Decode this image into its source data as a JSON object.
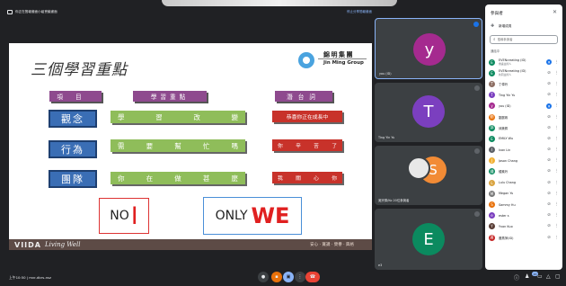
{
  "presentation": {
    "title": "你正在簡報畫面小組會議畫面",
    "right_text": "停止分享簡報畫面"
  },
  "slide": {
    "title": "三個學習重點",
    "logo": {
      "cn": "錦明集團",
      "en": "Jin Ming Group"
    },
    "headers": [
      "項目",
      "學習重點",
      "潛台詞"
    ],
    "rows": [
      {
        "category": "觀念",
        "points": [
          "學",
          "習",
          "改",
          "變"
        ],
        "encouragement": "恭喜你正在成長中"
      },
      {
        "category": "行為",
        "points": [
          "需",
          "要",
          "幫",
          "忙",
          "嗎"
        ],
        "encouragement": [
          "你",
          "辛",
          "苦",
          "了"
        ]
      },
      {
        "category": "團隊",
        "points": [
          "你",
          "在",
          "做",
          "甚",
          "麼"
        ],
        "encouragement": [
          "我",
          "關",
          "心",
          "你"
        ]
      }
    ],
    "no_box": {
      "small": "NO",
      "big": "I"
    },
    "only_box": {
      "small": "ONLY",
      "big": "WE"
    },
    "footer": {
      "brand": "VIIDA",
      "tagline": "Living Well",
      "right": "安心 · 賞識 · 榮譽 · 興格"
    }
  },
  "tiles": [
    {
      "initial": "y",
      "color": "#a52a8f",
      "name": "you (ID)"
    },
    {
      "initial": "T",
      "color": "#7b3fbf",
      "name": "Ting Yin Yu"
    },
    {
      "initial": "S",
      "color": "#f28b35",
      "name": "吳宗偉/Ko 20位參與者"
    },
    {
      "initial": "E",
      "color": "#0b8a5f",
      "name": "e3"
    }
  ],
  "panel": {
    "title": "參與者",
    "add_label": "新增成員",
    "search_placeholder": "搜尋參與者",
    "in_call_label": "通話中",
    "participants": [
      {
        "initial": "E",
        "color": "#0b8a5f",
        "name": "EVENcreating (ID)",
        "sub": "會議主持人",
        "mic": "blue"
      },
      {
        "initial": "E",
        "color": "#0b8a5f",
        "name": "EVENcreating (ID)",
        "sub": "共同主持人",
        "mic": "muted"
      },
      {
        "initial": "丁",
        "color": "#8d6e63",
        "name": "丁偉玲",
        "sub": "",
        "mic": "muted"
      },
      {
        "initial": "T",
        "color": "#7b3fbf",
        "name": "Ting Yin Yu",
        "sub": "",
        "mic": "muted"
      },
      {
        "initial": "y",
        "color": "#a52a8f",
        "name": "you (ID)",
        "sub": "",
        "mic": "blue"
      },
      {
        "initial": "劉",
        "color": "#e8710a",
        "name": "劉麗珠",
        "sub": "",
        "mic": "muted"
      },
      {
        "initial": "邱",
        "color": "#0b8a5f",
        "name": "邱美佩",
        "sub": "",
        "mic": "muted"
      },
      {
        "initial": "E",
        "color": "#0b8a5f",
        "name": "EMILY Wu",
        "sub": "",
        "mic": "muted"
      },
      {
        "initial": "I",
        "color": "#5f6368",
        "name": "Ivan Lin",
        "sub": "",
        "mic": "muted"
      },
      {
        "initial": "J",
        "color": "#f2b134",
        "name": "Jason Chang",
        "sub": "",
        "mic": "muted"
      },
      {
        "initial": "鍾",
        "color": "#0b8a5f",
        "name": "鍾素玲",
        "sub": "",
        "mic": "muted"
      },
      {
        "initial": "L",
        "color": "#d9a441",
        "name": "Lulu Chang",
        "sub": "",
        "mic": "muted"
      },
      {
        "initial": "M",
        "color": "#7a7a7a",
        "name": "Megan Yu",
        "sub": "",
        "mic": "muted"
      },
      {
        "initial": "S",
        "color": "#e8710a",
        "name": "Sammy Hu",
        "sub": "",
        "mic": "muted"
      },
      {
        "initial": "e",
        "color": "#7b3fbf",
        "name": "ester s",
        "sub": "",
        "mic": "muted"
      },
      {
        "initial": "Y",
        "color": "#5a3e36",
        "name": "Yvon Kuo",
        "sub": "",
        "mic": "muted"
      },
      {
        "initial": "蕭",
        "color": "#c62828",
        "name": "蕭燕萍(ID)",
        "sub": "",
        "mic": "muted"
      }
    ]
  },
  "bottom": {
    "time": "上午10:50 | mvr-dbrs-nsz",
    "participant_count": "20"
  }
}
